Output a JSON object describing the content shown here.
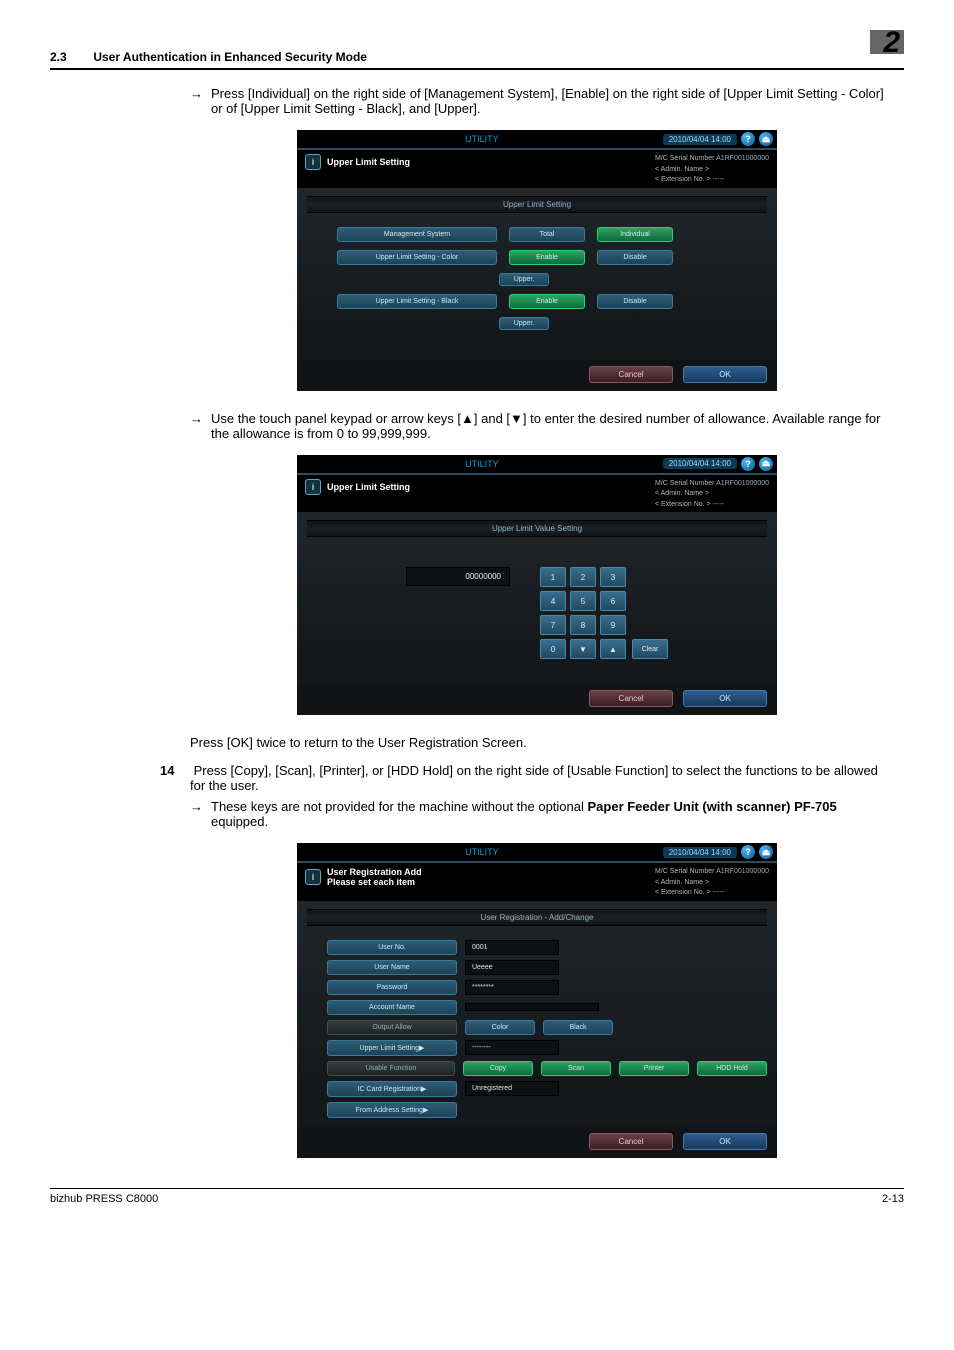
{
  "header": {
    "section_num": "2.3",
    "section_title": "User Authentication in Enhanced Security Mode",
    "chapter_num": "2"
  },
  "body": {
    "bullet1": "Press [Individual] on the right side of [Management System], [Enable] on the right side of [Upper Limit Setting - Color] or of [Upper Limit Setting - Black], and [Upper].",
    "bullet2_a": "Use the touch panel keypad or arrow keys [▲] and [▼] to enter the desired number of allowance.",
    "bullet2_b": "Available range for the allowance is from 0 to 99,999,999.",
    "para_mid": "Press [OK] twice to return to the User Registration Screen.",
    "step14_num": "14",
    "step14_text": "Press [Copy], [Scan], [Printer], or [HDD Hold] on the right side of [Usable Function] to select the functions to be allowed for the user.",
    "step14_sub_a": "These keys are not provided for the machine without the optional ",
    "step14_sub_bold": "Paper Feeder Unit (with scanner) PF-705",
    "step14_sub_b": " equipped."
  },
  "panel_common": {
    "utility": "UTILITY",
    "timestamp": "2010/04/04 14:00",
    "serial_lbl": "M/C Serial Number",
    "serial_val": "A1RF001000000",
    "admin_lbl": "< Admin. Name >",
    "ext_lbl": "< Extension No. >",
    "ext_val": "-----",
    "cancel": "Cancel",
    "ok": "OK"
  },
  "panel1": {
    "title": "Upper Limit Setting",
    "band": "Upper Limit Setting",
    "rows": {
      "mgmt_lbl": "Management System",
      "mgmt_total": "Total",
      "mgmt_indiv": "Individual",
      "color_lbl": "Upper Limit Setting - Color",
      "enable": "Enable",
      "disable": "Disable",
      "upper": "Upper.",
      "black_lbl": "Upper Limit Setting - Black"
    }
  },
  "panel2": {
    "title": "Upper Limit Setting",
    "band": "Upper Limit Value Setting",
    "display": "00000000",
    "keys": {
      "k1": "1",
      "k2": "2",
      "k3": "3",
      "k4": "4",
      "k5": "5",
      "k6": "6",
      "k7": "7",
      "k8": "8",
      "k9": "9",
      "k0": "0",
      "down": "▼",
      "up": "▲",
      "clear": "Clear"
    }
  },
  "panel3": {
    "title_a": "User Registration Add",
    "title_b": "Please set each item",
    "band": "User Registration - Add/Change",
    "rows": {
      "user_no_lbl": "User No.",
      "user_no_val": "0001",
      "user_name_lbl": "User Name",
      "user_name_val": "Ueeee",
      "password_lbl": "Password",
      "password_val": "********",
      "account_lbl": "Account Name",
      "output_lbl": "Output Allow",
      "color": "Color",
      "black": "Black",
      "upper_lbl": "Upper Limit Setting▶",
      "upper_val": "--------",
      "usable_lbl": "Usable Function",
      "copy": "Copy",
      "scan": "Scan",
      "printer": "Printer",
      "hdd": "HDD Hold",
      "iccard_lbl": "IC Card Registration▶",
      "iccard_val": "Unregistered",
      "from_lbl": "From Address Setting▶"
    }
  },
  "footer": {
    "left": "bizhub PRESS C8000",
    "right": "2-13"
  }
}
